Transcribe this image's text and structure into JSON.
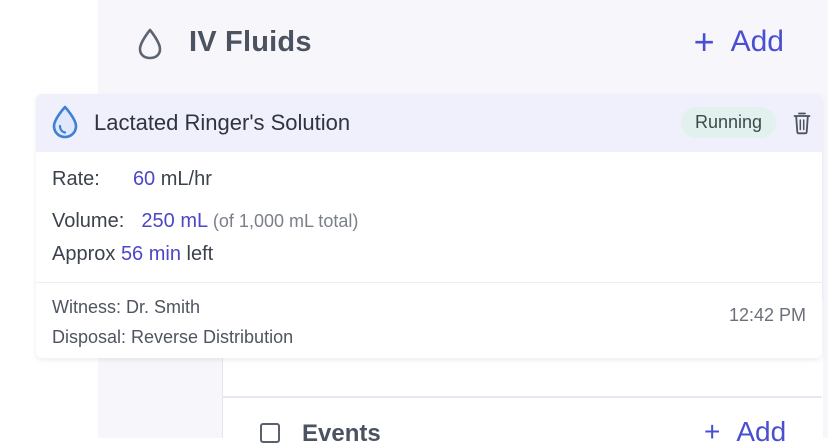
{
  "header": {
    "icon": "droplet-outline-icon",
    "title": "IV Fluids",
    "add_label": "Add",
    "add_icon": "plus-icon"
  },
  "fluid_card": {
    "icon": "droplet-icon",
    "name": "Lactated Ringer's Solution",
    "status": "Running",
    "status_bg": "#e3f1ee",
    "delete_icon": "trash-icon",
    "rate_label": "Rate:",
    "rate_value": "60",
    "rate_unit": "mL/hr",
    "volume_label": "Volume:",
    "volume_value": "250 mL",
    "volume_total": "(of 1,000 mL total)",
    "approx_label": "Approx",
    "approx_value": "56 min",
    "approx_suffix": "left",
    "witness": "Witness: Dr. Smith",
    "disposal": "Disposal: Reverse Distribution",
    "time": "12:42 PM"
  },
  "events": {
    "title": "Events",
    "add_label": "Add"
  },
  "colors": {
    "accent": "#4a4fd1",
    "card_header_bg": "#eff0fb"
  }
}
